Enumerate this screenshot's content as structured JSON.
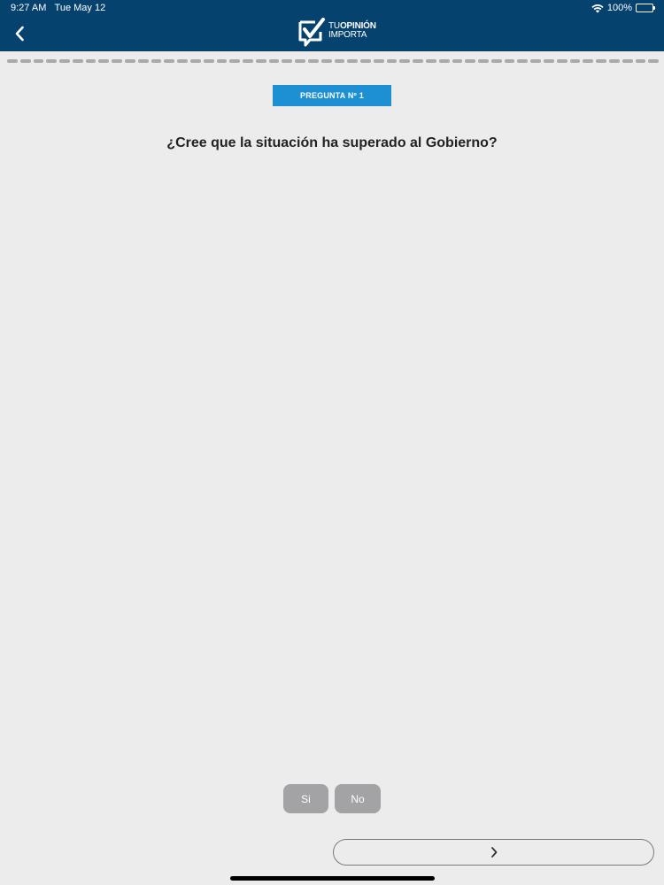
{
  "status_bar": {
    "time": "9:27 AM",
    "date": "Tue May 12",
    "battery": "100%"
  },
  "header": {
    "logo_line1_a": "TU",
    "logo_line1_b": "OPINIÓN",
    "logo_line2": "IMPORTA",
    "back_icon": "chevron-left-icon",
    "color": "#06426e"
  },
  "progress": {
    "total_steps": 50
  },
  "question": {
    "badge": "PREGUNTA Nº 1",
    "text": "¿Cree que la situación ha superado al Gobierno?",
    "badge_color": "#1d90d3"
  },
  "answers": [
    {
      "label": "Si"
    },
    {
      "label": "No"
    }
  ],
  "navigation": {
    "next_icon": "chevron-right-icon"
  }
}
